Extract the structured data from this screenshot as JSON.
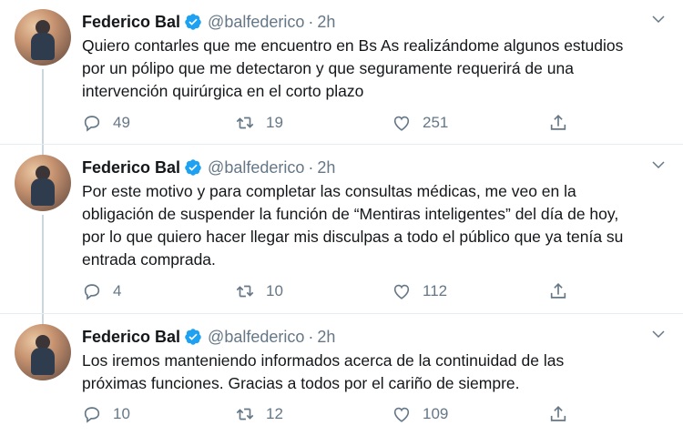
{
  "tweets": [
    {
      "name": "Federico Bal",
      "handle": "@balfederico",
      "dot": "·",
      "time": "2h",
      "lines": [
        "Quiero contarles que me encuentro en Bs As realizándome algunos estudios",
        "por un pólipo que me detectaron y que seguramente requerirá de una",
        "intervención quirúrgica en el corto plazo"
      ],
      "replies": "49",
      "retweets": "19",
      "likes": "251"
    },
    {
      "name": "Federico Bal",
      "handle": "@balfederico",
      "dot": "·",
      "time": "2h",
      "lines": [
        "Por este motivo y para completar las consultas médicas, me veo en la",
        "obligación de suspender la función de “Mentiras inteligentes” del día de hoy,",
        "por lo que quiero hacer llegar mis disculpas a todo el público que ya tenía su",
        "entrada comprada."
      ],
      "replies": "4",
      "retweets": "10",
      "likes": "112"
    },
    {
      "name": "Federico Bal",
      "handle": "@balfederico",
      "dot": "·",
      "time": "2h",
      "lines": [
        "Los iremos manteniendo informados acerca de la continuidad de las",
        "próximas funciones. Gracias a todos por el cariño de siempre."
      ],
      "replies": "10",
      "retweets": "12",
      "likes": "109"
    }
  ],
  "colors": {
    "accent": "#1da1f2",
    "secondary_text": "#657786",
    "thread_line": "#ccd6dd"
  },
  "icons": [
    "verified-badge-icon",
    "chevron-down-icon",
    "reply-icon",
    "retweet-icon",
    "like-icon",
    "share-icon"
  ]
}
